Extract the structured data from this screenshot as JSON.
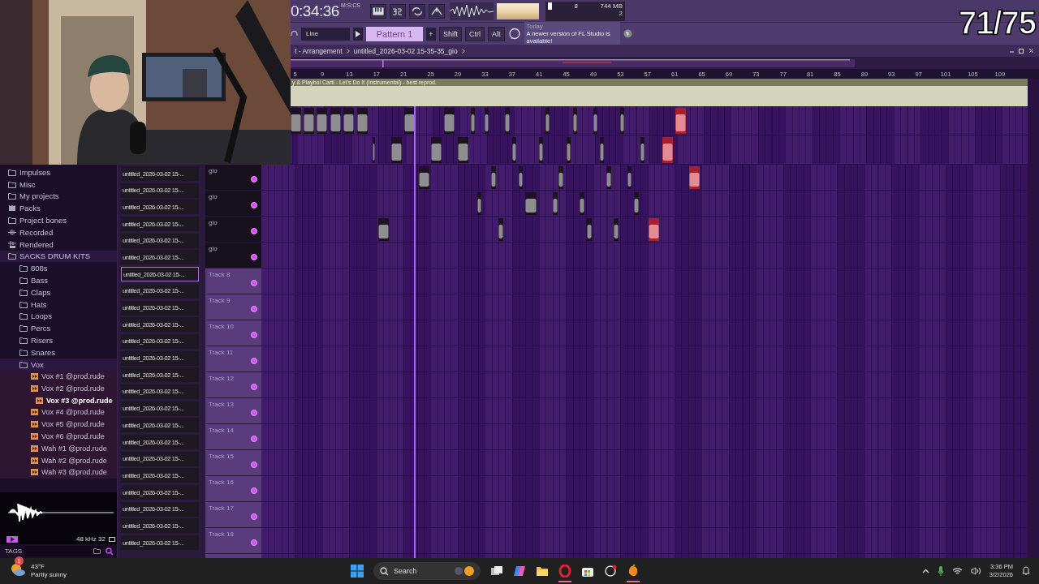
{
  "stream_counter": "71/75",
  "toolbar": {
    "time": "0:34:36",
    "time_format": "M:S:CS",
    "cpu": "8",
    "memory": "744 MB",
    "polyphony": "2",
    "snap": "Line",
    "pattern": "Pattern 1",
    "pattern_add": "+",
    "modifiers": [
      "Shift",
      "Ctrl",
      "Alt"
    ],
    "hint_when": "Today",
    "hint": "A newer version of FL Studio is available!"
  },
  "playlist": {
    "breadcrumb": [
      "t - Arrangement",
      "untitled_2026-03-02 15-35-35_gio"
    ],
    "ruler": [
      "5",
      "9",
      "13",
      "17",
      "21",
      "25",
      "29",
      "33",
      "37",
      "41",
      "45",
      "49",
      "53",
      "57",
      "61",
      "65",
      "69",
      "73",
      "77",
      "81",
      "85",
      "89",
      "93",
      "97",
      "101",
      "105",
      "109"
    ],
    "audio_track": {
      "title": "y & Playboi Carti - Let's Do It (Instrumental) - best reprod."
    },
    "tracks": [
      {
        "name": "gio",
        "color": "#17101d"
      },
      {
        "name": "gio",
        "color": "#17101d"
      },
      {
        "name": "gio",
        "color": "#17101d"
      },
      {
        "name": "gio",
        "color": "#17101d"
      },
      {
        "name": "Track 8",
        "color": "#5a3c7c"
      },
      {
        "name": "Track 9",
        "color": "#5a3c7c"
      },
      {
        "name": "Track 10",
        "color": "#5a3c7c"
      },
      {
        "name": "Track 11",
        "color": "#5a3c7c"
      },
      {
        "name": "Track 12",
        "color": "#5a3c7c"
      },
      {
        "name": "Track 13",
        "color": "#5a3c7c"
      },
      {
        "name": "Track 14",
        "color": "#5a3c7c"
      },
      {
        "name": "Track 15",
        "color": "#5a3c7c"
      },
      {
        "name": "Track 16",
        "color": "#5a3c7c"
      },
      {
        "name": "Track 17",
        "color": "#5a3c7c"
      },
      {
        "name": "Track 18",
        "color": "#5a3c7c"
      }
    ]
  },
  "browser": {
    "items": [
      {
        "label": "Impulses",
        "kind": "folder",
        "selected": false
      },
      {
        "label": "Misc",
        "kind": "folder",
        "selected": false
      },
      {
        "label": "My projects",
        "kind": "folder",
        "selected": false
      },
      {
        "label": "Packs",
        "kind": "pack",
        "selected": false
      },
      {
        "label": "Project bones",
        "kind": "folder",
        "selected": false
      },
      {
        "label": "Recorded",
        "kind": "recorded",
        "selected": false
      },
      {
        "label": "Rendered",
        "kind": "rendered",
        "selected": false
      },
      {
        "label": "SACKS DRUM KITS",
        "kind": "folder",
        "selected": false,
        "children": [
          {
            "label": "808s",
            "kind": "folder",
            "selected": false
          },
          {
            "label": "Bass",
            "kind": "folder",
            "selected": false
          },
          {
            "label": "Claps",
            "kind": "folder",
            "selected": false
          },
          {
            "label": "Hats",
            "kind": "folder",
            "selected": false
          },
          {
            "label": "Loops",
            "kind": "folder",
            "selected": false
          },
          {
            "label": "Percs",
            "kind": "folder",
            "selected": false
          },
          {
            "label": "Risers",
            "kind": "folder",
            "selected": false
          },
          {
            "label": "Snares",
            "kind": "folder",
            "selected": false
          },
          {
            "label": "Vox",
            "kind": "folder",
            "selected": false,
            "children": [
              {
                "label": "Vox #1 @prod.rude",
                "kind": "audio",
                "selected": false
              },
              {
                "label": "Vox #2 @prod.rude",
                "kind": "audio",
                "selected": false
              },
              {
                "label": "Vox #3 @prod.rude",
                "kind": "audio",
                "selected": true
              },
              {
                "label": "Vox #4 @prod.rude",
                "kind": "audio",
                "selected": false
              },
              {
                "label": "Vox #5 @prod.rude",
                "kind": "audio",
                "selected": false
              },
              {
                "label": "Vox #6 @prod.rude",
                "kind": "audio",
                "selected": false
              },
              {
                "label": "Wah #1 @prod.rude",
                "kind": "audio",
                "selected": false
              },
              {
                "label": "Wah #2 @prod.rude",
                "kind": "audio",
                "selected": false
              },
              {
                "label": "Wah #3 @prod.rude",
                "kind": "audio",
                "selected": false
              }
            ]
          }
        ]
      }
    ]
  },
  "preview": {
    "format": "48 kHz 32"
  },
  "tags": {
    "label": "TAGS"
  },
  "channels": [
    {
      "name": "untitled_2026-03-02 15-...",
      "selected": false
    },
    {
      "name": "untitled_2026-03-02 15-...",
      "selected": false
    },
    {
      "name": "untitled_2026-03-02 15-...",
      "selected": false
    },
    {
      "name": "untitled_2026-03-02 15-...",
      "selected": false
    },
    {
      "name": "untitled_2026-03-02 15-...",
      "selected": false
    },
    {
      "name": "untitled_2026-03-02 15-...",
      "selected": false
    },
    {
      "name": "untitled_2026-03-02 15-...",
      "selected": true
    },
    {
      "name": "untitled_2026-03-02 15-...",
      "selected": false
    },
    {
      "name": "untitled_2026-03-02 15-...",
      "selected": false
    },
    {
      "name": "untitled_2026-03-02 15-...",
      "selected": false
    },
    {
      "name": "untitled_2026-03-02 15-...",
      "selected": false
    },
    {
      "name": "untitled_2026-03-02 15-...",
      "selected": false
    },
    {
      "name": "untitled_2026-03-02 15-...",
      "selected": false
    },
    {
      "name": "untitled_2026-03-02 15-...",
      "selected": false
    },
    {
      "name": "untitled_2026-03-02 15-...",
      "selected": false
    },
    {
      "name": "untitled_2026-03-02 15-...",
      "selected": false
    },
    {
      "name": "untitled_2026-03-02 15-...",
      "selected": false
    },
    {
      "name": "untitled_2026-03-02 15-...",
      "selected": false
    },
    {
      "name": "untitled_2026-03-02 15-...",
      "selected": false
    },
    {
      "name": "untitled_2026-03-02 15-...",
      "selected": false
    },
    {
      "name": "untitled_2026-03-02 15-...",
      "selected": false
    },
    {
      "name": "untitled_2026-03-02 15-...",
      "selected": false
    },
    {
      "name": "untitled_2026-03-02 15-...",
      "selected": false
    }
  ],
  "taskbar": {
    "weather": {
      "badge": "1",
      "temperature": "43°F",
      "condition": "Partly sunny"
    },
    "search": {
      "placeholder": "Search"
    },
    "apps": [
      {
        "kind": "task-view",
        "open": false
      },
      {
        "kind": "copilot",
        "open": false
      },
      {
        "kind": "explorer",
        "open": false
      },
      {
        "kind": "opera",
        "open": true
      },
      {
        "kind": "store",
        "open": false
      },
      {
        "kind": "app",
        "open": false
      },
      {
        "kind": "fl",
        "open": true
      }
    ],
    "time": "3:36 PM",
    "date": "3/2/2026"
  }
}
